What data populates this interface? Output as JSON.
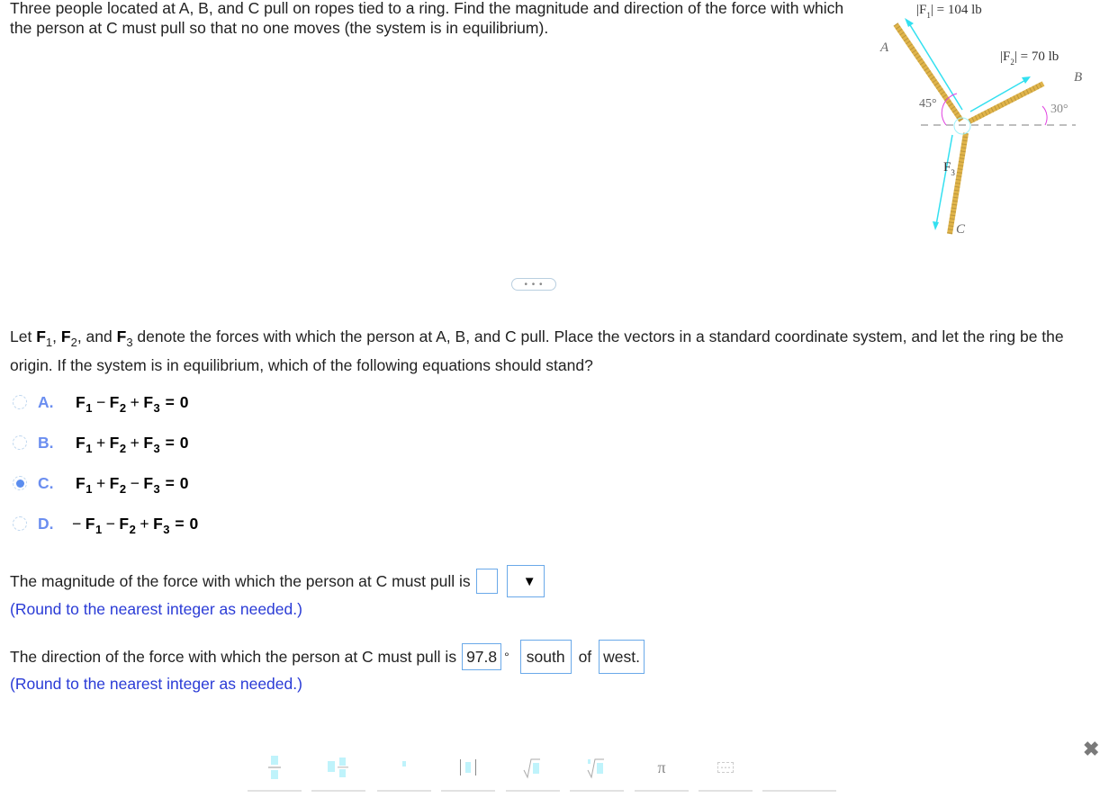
{
  "question": {
    "text": "Three people located at A, B, and C pull on ropes tied to a ring. Find the magnitude and direction of the force with which the person at C must pull so that no one moves (the system is in equilibrium)."
  },
  "diagram": {
    "f1_label": "|F",
    "f1_sub": "1",
    "f1_value": "| = 104 lb",
    "f2_label": "|F",
    "f2_sub": "2",
    "f2_value": "| = 70 lb",
    "f3_label": "F",
    "f3_sub": "3",
    "point_a": "A",
    "point_b": "B",
    "point_c": "C",
    "angle_a": "45°",
    "angle_b": "30°",
    "colors": {
      "arrow": "#33e0f0",
      "rope": "#e0b44a",
      "angle_arc": "#e040e0",
      "dash": "#a0a0a0"
    }
  },
  "expander": {
    "label": "• • •"
  },
  "prompt": {
    "part1": "Let ",
    "f": "F",
    "s1": "1",
    "s2": "2",
    "s3": "3",
    "comma": ", ",
    "and": ", and ",
    "part2": " denote the forces with which the person at A, B, and C pull. Place the vectors in a standard coordinate system, and let the ring be the origin. If the system is in equilibrium, which of the following equations should stand?"
  },
  "options": [
    {
      "letter": "A.",
      "signs": [
        "",
        "−",
        "+"
      ],
      "selected": false
    },
    {
      "letter": "B.",
      "signs": [
        "",
        "+",
        "+"
      ],
      "selected": false
    },
    {
      "letter": "C.",
      "signs": [
        "",
        "+",
        "−"
      ],
      "selected": true
    },
    {
      "letter": "D.",
      "signs": [
        "−",
        "−",
        "+"
      ],
      "selected": false
    }
  ],
  "option_terms": {
    "f": "F",
    "s1": "1",
    "s2": "2",
    "s3": "3",
    "rhs": "= 0"
  },
  "magnitude": {
    "text": "The magnitude of the force with which the person at C must pull is",
    "value": "",
    "unit_dropdown_icon": "▼",
    "hint": "(Round to the nearest integer as needed.)"
  },
  "direction": {
    "text": "The direction of the force with which the person at C must pull is",
    "value": "97.8",
    "degree": "°",
    "dir1": "south",
    "of": "of",
    "dir2": "west.",
    "hint": "(Round to the nearest integer as needed.)"
  },
  "toolbar": {
    "buttons": [
      "fraction",
      "mixed-number",
      "exponent",
      "absolute-value",
      "square-root",
      "nth-root",
      "pi",
      "more"
    ],
    "pi_glyph": "π",
    "more_glyph": "⋯"
  },
  "close": {
    "glyph": "✖"
  }
}
